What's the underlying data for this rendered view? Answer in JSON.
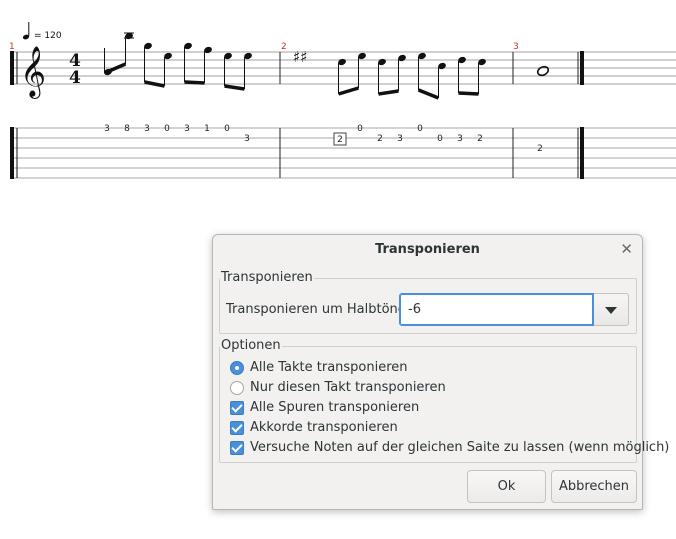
{
  "score": {
    "tempo_value": "= 120",
    "measure_numbers": [
      "1",
      "2",
      "3"
    ],
    "time_signature": {
      "top": "4",
      "bottom": "4"
    },
    "key_signature": "♯♯",
    "tab_numbers": {
      "m1": [
        "3",
        "8",
        "3",
        "0",
        "3",
        "1",
        "0",
        "3"
      ],
      "m2": [
        "2",
        "0",
        "2",
        "3",
        "0",
        "0",
        "3",
        "2"
      ],
      "m3": [
        "2"
      ]
    },
    "colors": {
      "measure_number": "#c0392b",
      "staff": "#9a9a9a",
      "notes": "#1a1a1a"
    }
  },
  "dialog": {
    "title": "Transponieren",
    "close_icon": "close-icon",
    "group_transpose": {
      "legend": "Transponieren",
      "label": "Transponieren um Halbtöne",
      "value": "-6"
    },
    "group_options": {
      "legend": "Optionen",
      "radios": [
        {
          "label": "Alle Takte transponieren",
          "selected": true
        },
        {
          "label": "Nur diesen Takt transponieren",
          "selected": false
        }
      ],
      "checkboxes": [
        {
          "label": "Alle Spuren transponieren",
          "checked": true
        },
        {
          "label": "Akkorde transponieren",
          "checked": true
        },
        {
          "label": "Versuche Noten auf der gleichen Saite zu lassen (wenn möglich)",
          "checked": true
        }
      ]
    },
    "buttons": {
      "ok": "Ok",
      "cancel": "Abbrechen"
    },
    "accent_color": "#4a90d9"
  }
}
